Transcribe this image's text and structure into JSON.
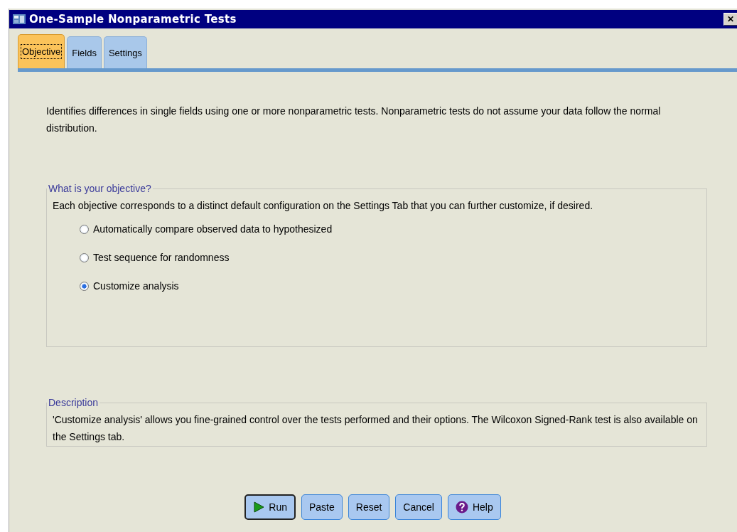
{
  "window": {
    "title": "One-Sample Nonparametric Tests",
    "close": "✕"
  },
  "tabs": [
    {
      "label": "Objective",
      "selected": true
    },
    {
      "label": "Fields",
      "selected": false
    },
    {
      "label": "Settings",
      "selected": false
    }
  ],
  "intro": "Identifies differences in single fields using one or more nonparametric tests. Nonparametric tests do not assume your data follow the normal distribution.",
  "objective_group": {
    "legend": "What is your objective?",
    "text": "Each objective corresponds to a distinct default configuration on the Settings Tab that you can further customize, if desired.",
    "options": [
      {
        "label": "Automatically compare observed data to hypothesized",
        "selected": false
      },
      {
        "label": "Test sequence for randomness",
        "selected": false
      },
      {
        "label": "Customize analysis",
        "selected": true
      }
    ]
  },
  "description_group": {
    "legend": "Description",
    "text": "'Customize analysis' allows you fine-grained control over the tests performed and their options.  The Wilcoxon Signed-Rank test is also available on the Settings tab."
  },
  "buttons": [
    {
      "label": "Run",
      "kind": "run"
    },
    {
      "label": "Paste",
      "kind": "plain"
    },
    {
      "label": "Reset",
      "kind": "plain"
    },
    {
      "label": "Cancel",
      "kind": "plain"
    },
    {
      "label": "Help",
      "kind": "help"
    }
  ]
}
